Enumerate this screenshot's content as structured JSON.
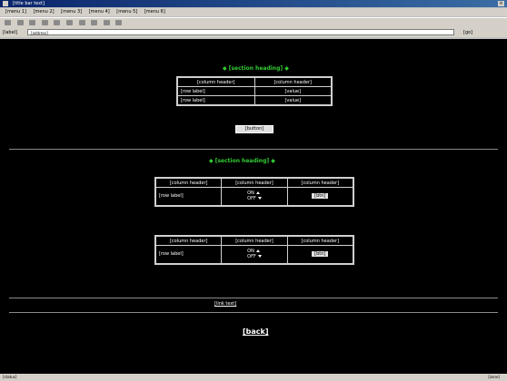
{
  "window": {
    "title": "[title bar text]",
    "close": "×"
  },
  "menubar": {
    "items": [
      "[menu 1]",
      "[menu 2]",
      "[menu 3]",
      "[menu 4]",
      "[menu 5]",
      "[menu 6]"
    ]
  },
  "addressbar": {
    "label": "[label]",
    "url": "[address]",
    "go": "[go]"
  },
  "section1": {
    "title": "◆ [section heading] ◆",
    "table": {
      "headers": [
        "[column header]",
        "[column header]"
      ],
      "rows": [
        [
          "[row label]",
          "[value]"
        ],
        [
          "[row label]",
          "[value]"
        ]
      ]
    },
    "button": "[button]"
  },
  "section2": {
    "title": "◆ [section heading] ◆",
    "tables": [
      {
        "headers": [
          "[column header]",
          "[column header]",
          "[column header]"
        ],
        "row": {
          "name": "[row label]",
          "options": [
            "ON",
            "OFF"
          ],
          "button": "[btn]"
        }
      },
      {
        "headers": [
          "[column header]",
          "[column header]",
          "[column header]"
        ],
        "row": {
          "name": "[row label]",
          "options": [
            "ON",
            "OFF"
          ],
          "button": "[btn]"
        }
      }
    ]
  },
  "link_text": "[link text]",
  "back_text": "[back]",
  "status": {
    "left": "[status]",
    "right": "[zone]"
  }
}
